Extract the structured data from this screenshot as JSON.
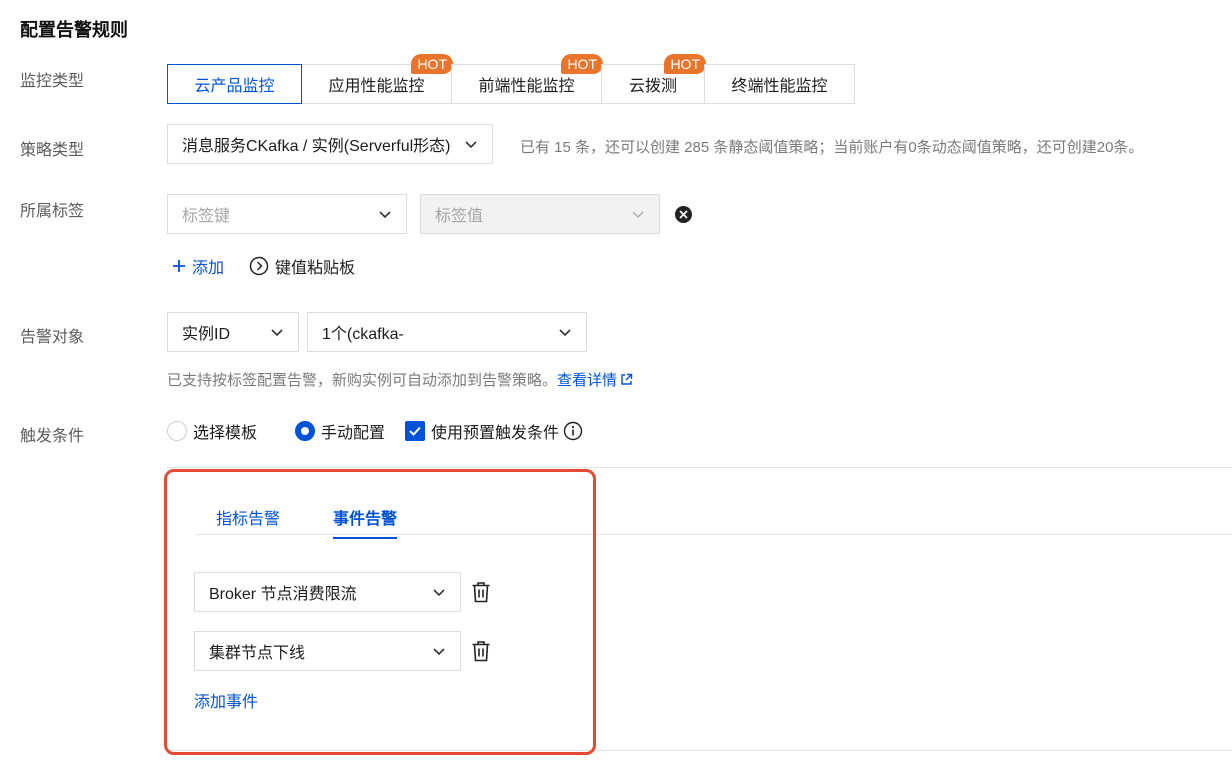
{
  "title": "配置告警规则",
  "labels": {
    "monitor_type": "监控类型",
    "policy_type": "策略类型",
    "tags": "所属标签",
    "alarm_object": "告警对象",
    "trigger": "触发条件"
  },
  "monitor_tabs": [
    {
      "label": "云产品监控",
      "hot": "",
      "active": true
    },
    {
      "label": "应用性能监控",
      "hot": "HOT"
    },
    {
      "label": "前端性能监控",
      "hot": "HOT"
    },
    {
      "label": "云拨测",
      "hot": "HOT"
    },
    {
      "label": "终端性能监控",
      "hot": ""
    }
  ],
  "policy": {
    "value": "消息服务CKafka / 实例(Serverful形态)",
    "hint": "已有 15 条，还可以创建 285 条静态阈值策略；当前账户有0条动态阈值策略，还可创建20条。"
  },
  "tags": {
    "key_placeholder": "标签键",
    "value_placeholder": "标签值",
    "add_label": "添加",
    "paste_label": "键值粘贴板"
  },
  "alarm_object": {
    "type_value": "实例ID",
    "instance_value": "1个(ckafka-",
    "hint": "已支持按标签配置告警，新购实例可自动添加到告警策略。",
    "hint_link": "查看详情"
  },
  "trigger": {
    "options": [
      "选择模板",
      "手动配置"
    ],
    "selected": "手动配置",
    "checkbox_label": "使用预置触发条件",
    "checkbox_checked": true
  },
  "panel": {
    "tabs": [
      "指标告警",
      "事件告警"
    ],
    "active_tab": "事件告警",
    "events": [
      "Broker 节点消费限流",
      "集群节点下线"
    ],
    "add_event_label": "添加事件"
  },
  "colors": {
    "primary": "#0052d9",
    "hot_badge": "#e8752b",
    "highlight": "#e34b33"
  }
}
